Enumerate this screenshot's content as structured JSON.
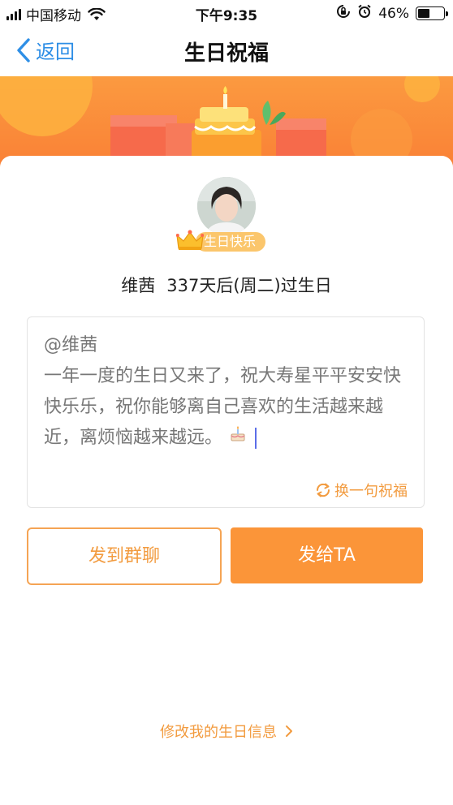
{
  "status_bar": {
    "carrier": "中国移动",
    "time": "下午9:35",
    "battery_percent": "46%",
    "battery_level": 0.46,
    "icons": [
      "signal-icon",
      "wifi-icon",
      "rotation-lock-icon",
      "alarm-icon",
      "battery-icon"
    ]
  },
  "nav": {
    "back_label": "返回",
    "title": "生日祝福"
  },
  "profile": {
    "badge_label": "生日快乐",
    "name": "维茜",
    "birthday_text": "337天后(周二)过生日"
  },
  "message": {
    "mention": "@维茜",
    "body": "一年一度的生日又来了，祝大寿星平平安安快快乐乐，祝你能够离自己喜欢的生活越来越近，离烦恼越来越远。",
    "emoji_icon": "cake-icon",
    "switch_label": "换一句祝福"
  },
  "actions": {
    "group_chat_label": "发到群聊",
    "send_label": "发给TA"
  },
  "footer": {
    "edit_label": "修改我的生日信息"
  },
  "colors": {
    "accent": "#fb9539",
    "banner": "#fb8f3a",
    "link_blue": "#2f8fe6",
    "badge": "#fbc66c"
  }
}
